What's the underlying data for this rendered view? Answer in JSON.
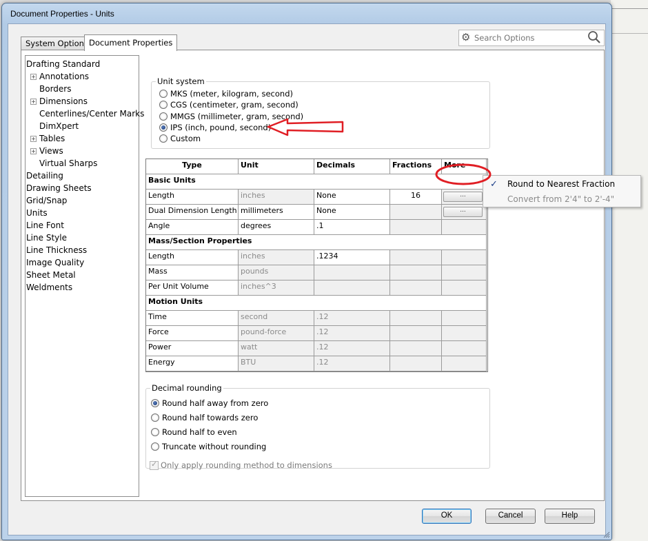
{
  "window": {
    "title": "Document Properties - Units"
  },
  "tabs": [
    {
      "label": "System Options",
      "active": false
    },
    {
      "label": "Document Properties",
      "active": true
    }
  ],
  "search": {
    "placeholder": "Search Options"
  },
  "tree": [
    {
      "label": "Drafting Standard",
      "level": 0,
      "expandable": false
    },
    {
      "label": "Annotations",
      "level": 1,
      "expandable": true
    },
    {
      "label": "Borders",
      "level": 1,
      "expandable": false
    },
    {
      "label": "Dimensions",
      "level": 1,
      "expandable": true
    },
    {
      "label": "Centerlines/Center Marks",
      "level": 1,
      "expandable": false
    },
    {
      "label": "DimXpert",
      "level": 1,
      "expandable": false
    },
    {
      "label": "Tables",
      "level": 1,
      "expandable": true
    },
    {
      "label": "Views",
      "level": 1,
      "expandable": true
    },
    {
      "label": "Virtual Sharps",
      "level": 1,
      "expandable": false
    },
    {
      "label": "Detailing",
      "level": 0,
      "expandable": false
    },
    {
      "label": "Drawing Sheets",
      "level": 0,
      "expandable": false
    },
    {
      "label": "Grid/Snap",
      "level": 0,
      "expandable": false
    },
    {
      "label": "Units",
      "level": 0,
      "expandable": false,
      "selected": true
    },
    {
      "label": "Line Font",
      "level": 0,
      "expandable": false
    },
    {
      "label": "Line Style",
      "level": 0,
      "expandable": false
    },
    {
      "label": "Line Thickness",
      "level": 0,
      "expandable": false
    },
    {
      "label": "Image Quality",
      "level": 0,
      "expandable": false
    },
    {
      "label": "Sheet Metal",
      "level": 0,
      "expandable": false
    },
    {
      "label": "Weldments",
      "level": 0,
      "expandable": false
    }
  ],
  "unit_system": {
    "title": "Unit system",
    "options": [
      {
        "label": "MKS  (meter, kilogram, second)",
        "selected": false
      },
      {
        "label": "CGS  (centimeter, gram, second)",
        "selected": false
      },
      {
        "label": "MMGS (millimeter, gram, second)",
        "selected": false
      },
      {
        "label": "IPS  (inch, pound, second)",
        "selected": true
      },
      {
        "label": "Custom",
        "selected": false
      }
    ]
  },
  "units_table": {
    "headers": [
      "Type",
      "Unit",
      "Decimals",
      "Fractions",
      "More"
    ],
    "rows": [
      {
        "kind": "section",
        "type": "Basic Units"
      },
      {
        "kind": "row",
        "type": "Length",
        "unit": "inches",
        "decimals": "None",
        "fractions": "16",
        "more": "...",
        "unit_editable": false,
        "dec_editable": true,
        "frac_editable": true
      },
      {
        "kind": "row",
        "type": "Dual Dimension Length",
        "unit": "millimeters",
        "decimals": "None",
        "fractions": "",
        "more": "...",
        "unit_editable": true,
        "dec_editable": true,
        "frac_editable": false
      },
      {
        "kind": "row",
        "type": "Angle",
        "unit": "degrees",
        "decimals": ".1",
        "fractions": "",
        "more": "",
        "unit_editable": true,
        "dec_editable": true,
        "frac_editable": false
      },
      {
        "kind": "section",
        "type": "Mass/Section Properties"
      },
      {
        "kind": "row",
        "type": "Length",
        "unit": "inches",
        "decimals": ".1234",
        "fractions": "",
        "more": "",
        "unit_editable": false,
        "dec_editable": true,
        "frac_editable": false
      },
      {
        "kind": "row",
        "type": "Mass",
        "unit": "pounds",
        "decimals": "",
        "fractions": "",
        "more": "",
        "unit_editable": false,
        "dec_editable": false,
        "frac_editable": false
      },
      {
        "kind": "row",
        "type": "Per Unit Volume",
        "unit": "inches^3",
        "decimals": "",
        "fractions": "",
        "more": "",
        "unit_editable": false,
        "dec_editable": false,
        "frac_editable": false
      },
      {
        "kind": "section",
        "type": "Motion Units"
      },
      {
        "kind": "row",
        "type": "Time",
        "unit": "second",
        "decimals": ".12",
        "fractions": "",
        "more": "",
        "unit_editable": false,
        "dec_editable": false,
        "frac_editable": false
      },
      {
        "kind": "row",
        "type": "Force",
        "unit": "pound-force",
        "decimals": ".12",
        "fractions": "",
        "more": "",
        "unit_editable": false,
        "dec_editable": false,
        "frac_editable": false
      },
      {
        "kind": "row",
        "type": "Power",
        "unit": "watt",
        "decimals": ".12",
        "fractions": "",
        "more": "",
        "unit_editable": false,
        "dec_editable": false,
        "frac_editable": false
      },
      {
        "kind": "row",
        "type": "Energy",
        "unit": "BTU",
        "decimals": ".12",
        "fractions": "",
        "more": "",
        "unit_editable": false,
        "dec_editable": false,
        "frac_editable": false
      }
    ]
  },
  "more_menu": {
    "items": [
      {
        "label": "Round to Nearest Fraction",
        "checked": true,
        "enabled": true
      },
      {
        "label": "Convert from 2'4\" to 2'-4\"",
        "checked": false,
        "enabled": false
      }
    ]
  },
  "decimal_rounding": {
    "title": "Decimal rounding",
    "options": [
      {
        "label": "Round half away from zero",
        "selected": true
      },
      {
        "label": "Round half towards zero",
        "selected": false
      },
      {
        "label": "Round half to even",
        "selected": false
      },
      {
        "label": "Truncate without rounding",
        "selected": false
      }
    ]
  },
  "apply_rounding": {
    "label": "Only apply rounding method to dimensions",
    "checked": true,
    "enabled": false
  },
  "buttons": {
    "ok": "OK",
    "cancel": "Cancel",
    "help": "Help"
  },
  "annotation_color": "#e01e24"
}
